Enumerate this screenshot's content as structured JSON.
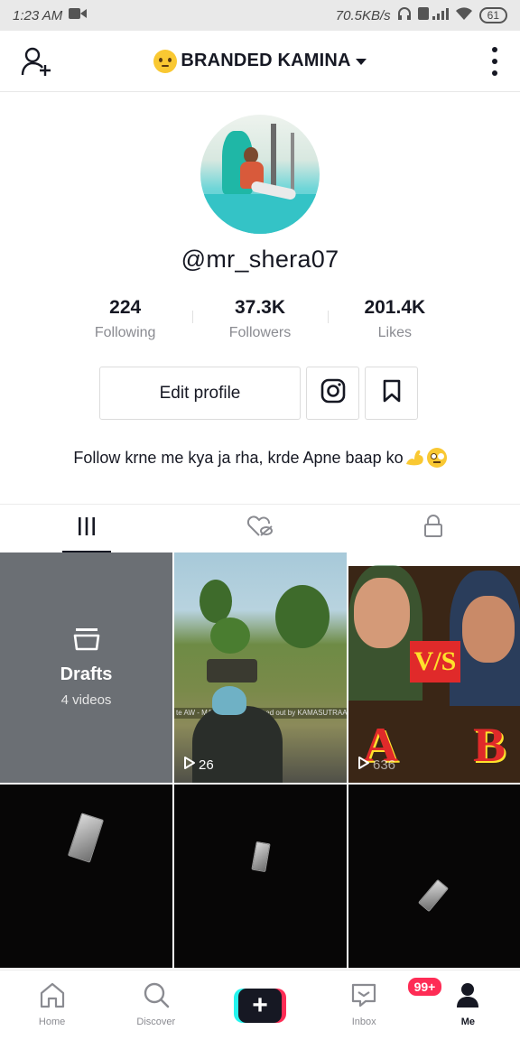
{
  "status_bar": {
    "time": "1:23 AM",
    "net_speed": "70.5KB/s",
    "battery": "61"
  },
  "header": {
    "title": "BRANDED KAMINA"
  },
  "profile": {
    "username": "@mr_shera07",
    "stats": [
      {
        "value": "224",
        "label": "Following"
      },
      {
        "value": "37.3K",
        "label": "Followers"
      },
      {
        "value": "201.4K",
        "label": "Likes"
      }
    ],
    "edit_button": "Edit profile",
    "bio": "Follow krne me kya ja rha, krde Apne baap ko"
  },
  "grid": {
    "drafts": {
      "title": "Drafts",
      "subtitle": "4 videos"
    },
    "items": [
      {
        "views": "26",
        "killfeed": "te AW - MAKKI... was knocked out by KAMASUTRAA"
      },
      {
        "views": "636",
        "overlay": "V/S",
        "left_letter": "A",
        "right_letter": "B"
      }
    ]
  },
  "bottom_nav": {
    "items": [
      {
        "label": "Home"
      },
      {
        "label": "Discover"
      },
      {
        "label": ""
      },
      {
        "label": "Inbox",
        "badge": "99+"
      },
      {
        "label": "Me"
      }
    ]
  },
  "colors": {
    "primary_text": "#161823",
    "secondary_text": "#8a8b91",
    "accent_red": "#fe2c55",
    "accent_cyan": "#25f4ee"
  }
}
